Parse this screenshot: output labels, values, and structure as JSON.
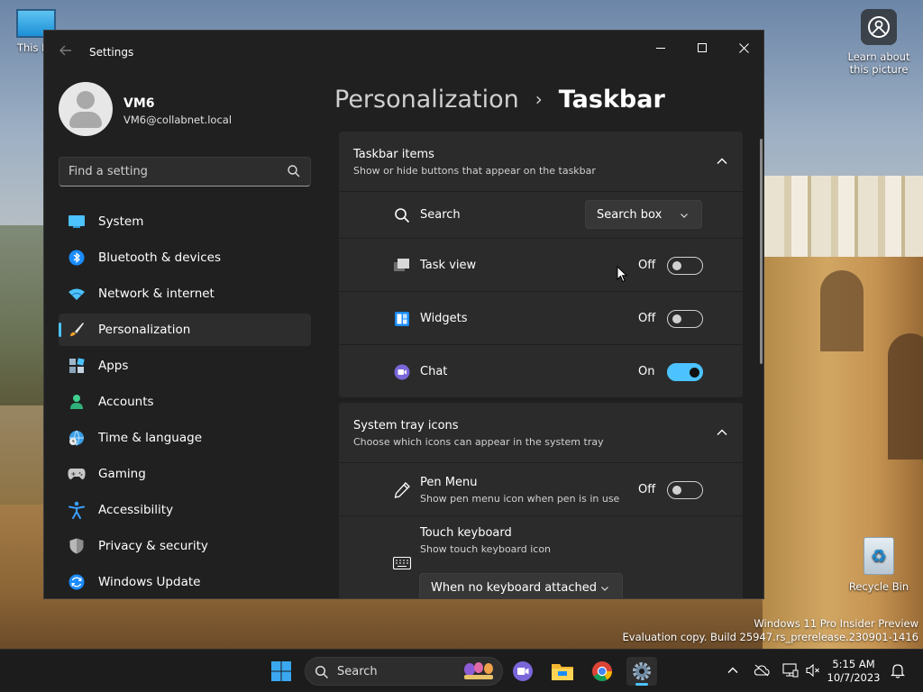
{
  "desktop": {
    "this_pc_label": "This PC",
    "learn_label_line1": "Learn about",
    "learn_label_line2": "this picture",
    "recycle_label": "Recycle Bin",
    "watermark_line1": "Windows 11 Pro Insider Preview",
    "watermark_line2": "Evaluation copy. Build 25947.rs_prerelease.230901-1416"
  },
  "window": {
    "title": "Settings",
    "controls": {
      "minimize": "–",
      "maximize": "□",
      "close": "✕"
    }
  },
  "profile": {
    "name": "VM6",
    "email": "VM6@collabnet.local"
  },
  "search": {
    "placeholder": "Find a setting"
  },
  "nav": {
    "items": [
      {
        "label": "System",
        "icon": "monitor-icon"
      },
      {
        "label": "Bluetooth & devices",
        "icon": "bluetooth-icon"
      },
      {
        "label": "Network & internet",
        "icon": "wifi-icon"
      },
      {
        "label": "Personalization",
        "icon": "brush-icon",
        "active": true
      },
      {
        "label": "Apps",
        "icon": "apps-icon"
      },
      {
        "label": "Accounts",
        "icon": "person-icon"
      },
      {
        "label": "Time & language",
        "icon": "globe-clock-icon"
      },
      {
        "label": "Gaming",
        "icon": "gamepad-icon"
      },
      {
        "label": "Accessibility",
        "icon": "accessibility-icon"
      },
      {
        "label": "Privacy & security",
        "icon": "shield-icon"
      },
      {
        "label": "Windows Update",
        "icon": "update-icon"
      }
    ]
  },
  "breadcrumb": {
    "parent": "Personalization",
    "separator": "›",
    "current": "Taskbar"
  },
  "taskbar_items": {
    "title": "Taskbar items",
    "subtitle": "Show or hide buttons that appear on the taskbar",
    "search": {
      "label": "Search",
      "value": "Search box"
    },
    "task_view": {
      "label": "Task view",
      "state": "Off",
      "on": false
    },
    "widgets": {
      "label": "Widgets",
      "state": "Off",
      "on": false
    },
    "chat": {
      "label": "Chat",
      "state": "On",
      "on": true
    }
  },
  "system_tray": {
    "title": "System tray icons",
    "subtitle": "Choose which icons can appear in the system tray",
    "pen_menu": {
      "label": "Pen Menu",
      "sub": "Show pen menu icon when pen is in use",
      "state": "Off",
      "on": false
    },
    "touch_keyboard": {
      "label": "Touch keyboard",
      "sub": "Show touch keyboard icon",
      "value": "When no keyboard attached"
    }
  },
  "taskbar": {
    "search_label": "Search",
    "time": "5:15 AM",
    "date": "10/7/2023"
  },
  "colors": {
    "accent": "#4cc2ff",
    "window_bg": "#202020",
    "card_bg": "#2b2b2b"
  }
}
